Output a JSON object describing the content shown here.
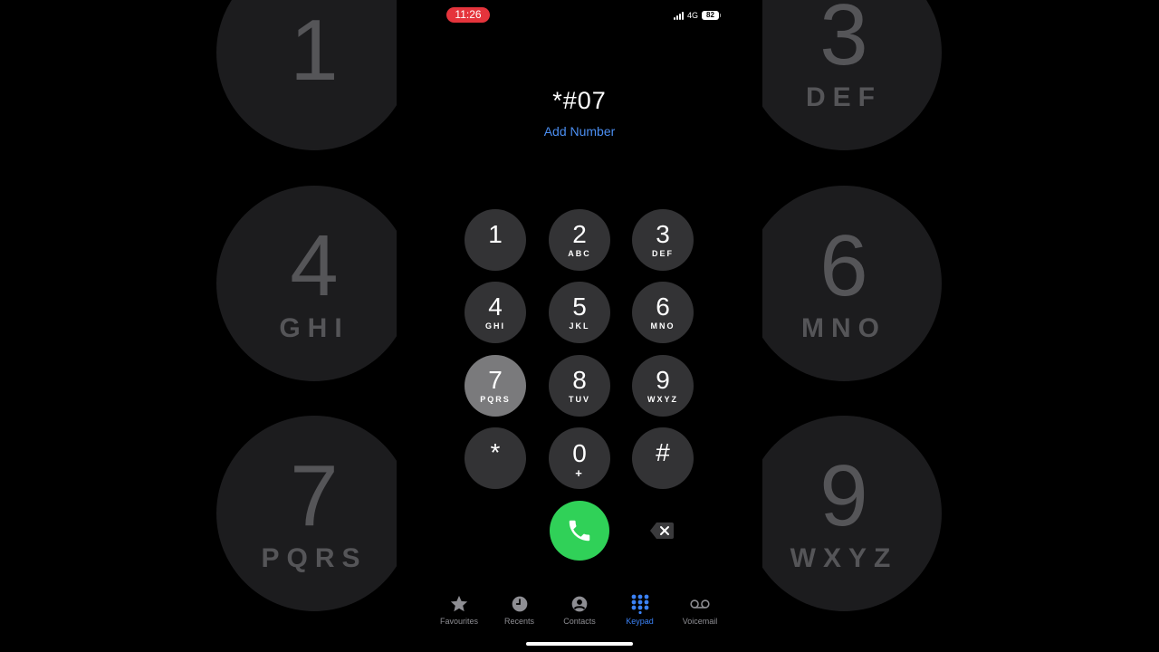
{
  "status_bar": {
    "time": "11:26",
    "network": "4G",
    "battery": "82"
  },
  "dialer": {
    "entered_number": "*#07",
    "add_number_label": "Add Number"
  },
  "keypad": {
    "keys": [
      {
        "digit": "1",
        "letters": ""
      },
      {
        "digit": "2",
        "letters": "ABC"
      },
      {
        "digit": "3",
        "letters": "DEF"
      },
      {
        "digit": "4",
        "letters": "GHI"
      },
      {
        "digit": "5",
        "letters": "JKL"
      },
      {
        "digit": "6",
        "letters": "MNO"
      },
      {
        "digit": "7",
        "letters": "PQRS"
      },
      {
        "digit": "8",
        "letters": "TUV"
      },
      {
        "digit": "9",
        "letters": "WXYZ"
      },
      {
        "digit": "*",
        "letters": ""
      },
      {
        "digit": "0",
        "letters": "+"
      },
      {
        "digit": "#",
        "letters": ""
      }
    ],
    "pressed_key": "7"
  },
  "backdrop": {
    "left": [
      {
        "digit": "1",
        "letters": ""
      },
      {
        "digit": "4",
        "letters": "GHI"
      },
      {
        "digit": "7",
        "letters": "PQRS"
      }
    ],
    "right": [
      {
        "digit": "3",
        "letters": "DEF"
      },
      {
        "digit": "6",
        "letters": "MNO"
      },
      {
        "digit": "9",
        "letters": "WXYZ"
      }
    ]
  },
  "tabbar": {
    "tabs": [
      {
        "label": "Favourites",
        "icon": "star-icon"
      },
      {
        "label": "Recents",
        "icon": "clock-icon"
      },
      {
        "label": "Contacts",
        "icon": "person-circle-icon"
      },
      {
        "label": "Keypad",
        "icon": "keypad-grid-icon"
      },
      {
        "label": "Voicemail",
        "icon": "voicemail-icon"
      }
    ],
    "active": "Keypad"
  },
  "colors": {
    "call_green": "#30d158",
    "accent_blue": "#4b8ef1",
    "recording_red": "#e5343c",
    "key_bg": "#333335"
  }
}
